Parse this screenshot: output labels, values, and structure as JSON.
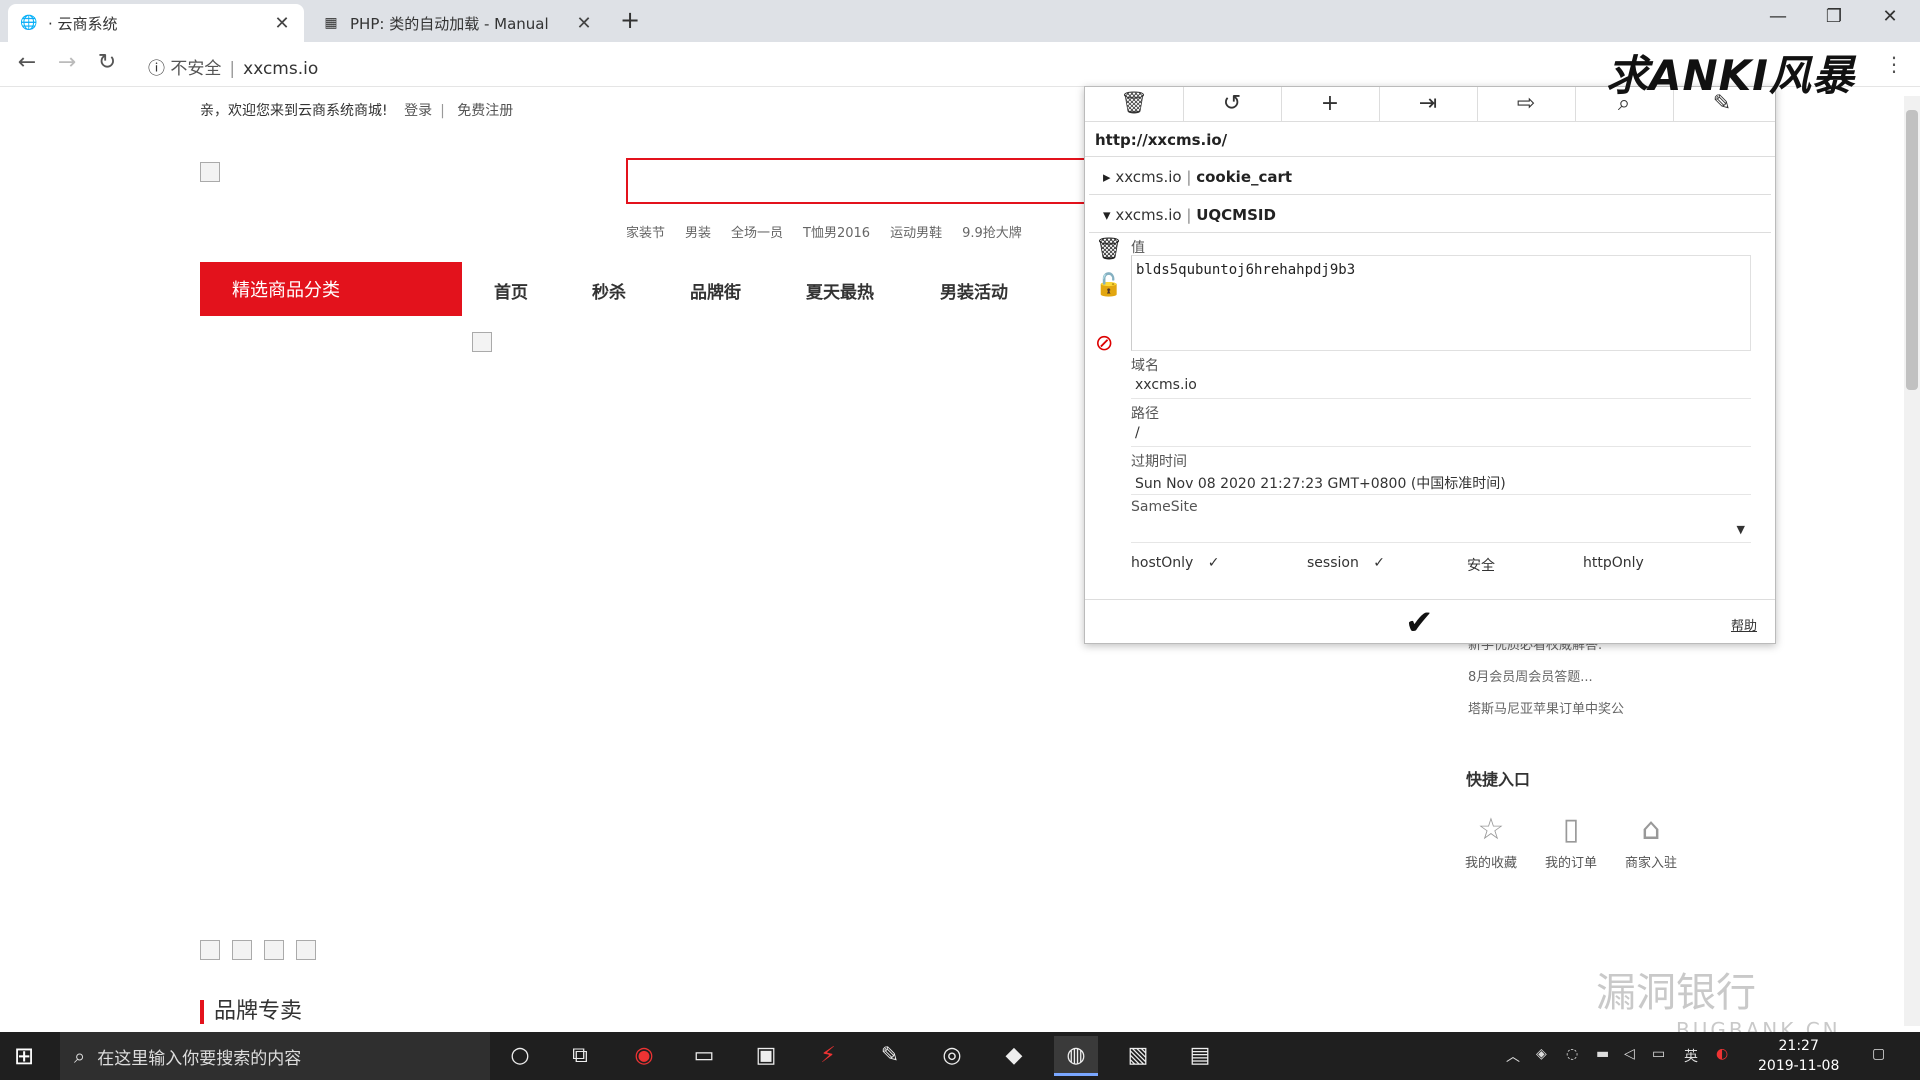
{
  "browser": {
    "tabs": [
      {
        "title": "· 云商系统",
        "icon": "globe-icon"
      },
      {
        "title": "PHP: 类的自动加载 - Manual",
        "icon": "php-icon"
      }
    ],
    "address": {
      "security": "不安全",
      "url": "xxcms.io"
    }
  },
  "page": {
    "welcome": "亲，欢迎您来到云商系统商城!",
    "login": "登录",
    "register": "免费注册",
    "hotwords": [
      "家装节",
      "男装",
      "全场一员",
      "T恤男2016",
      "运动男鞋",
      "9.9抢大牌"
    ],
    "category_button": "精选商品分类",
    "nav": [
      "首页",
      "秒杀",
      "品牌街",
      "夏天最热",
      "男装活动"
    ],
    "news": [
      "新手优质必看权威解答.",
      "8月会员周会员答题...",
      "塔斯马尼亚苹果订单中奖公"
    ],
    "quick_title": "快捷入口",
    "quick_links": [
      {
        "label": "我的收藏",
        "icon": "star-icon"
      },
      {
        "label": "我的订单",
        "icon": "clipboard-icon"
      },
      {
        "label": "商家入驻",
        "icon": "shop-icon"
      }
    ],
    "brand_title": "品牌专卖"
  },
  "cookie_editor": {
    "url": "http://xxcms.io/",
    "cookies": [
      {
        "domain": "xxcms.io",
        "name": "cookie_cart",
        "expanded": false
      },
      {
        "domain": "xxcms.io",
        "name": "UQCMSID",
        "expanded": true
      }
    ],
    "labels": {
      "value": "值",
      "domain": "域名",
      "path": "路径",
      "expires": "过期时间",
      "samesite": "SameSite",
      "hostonly": "hostOnly",
      "session": "session",
      "secure": "安全",
      "httponly": "httpOnly",
      "help": "帮助"
    },
    "value": "blds5qubuntoj6hrehahpdj9b3",
    "domain": "xxcms.io",
    "path": "/",
    "expires": "Sun Nov 08 2020 21:27:23 GMT+0800 (中国标准时间)",
    "samesite": "",
    "flags": {
      "hostonly": "✓",
      "session": "✓"
    }
  },
  "watermarks": {
    "top": "求ANKI风暴",
    "bottom": "漏洞银行",
    "bottom_sub": "BUGBANK.CN"
  },
  "taskbar": {
    "search_placeholder": "在这里输入你要搜索的内容",
    "time": "21:27",
    "date": "2019-11-08",
    "ime": "英"
  },
  "colors": {
    "brand_red": "#e3121c",
    "taskbar": "#1f1f1f"
  }
}
